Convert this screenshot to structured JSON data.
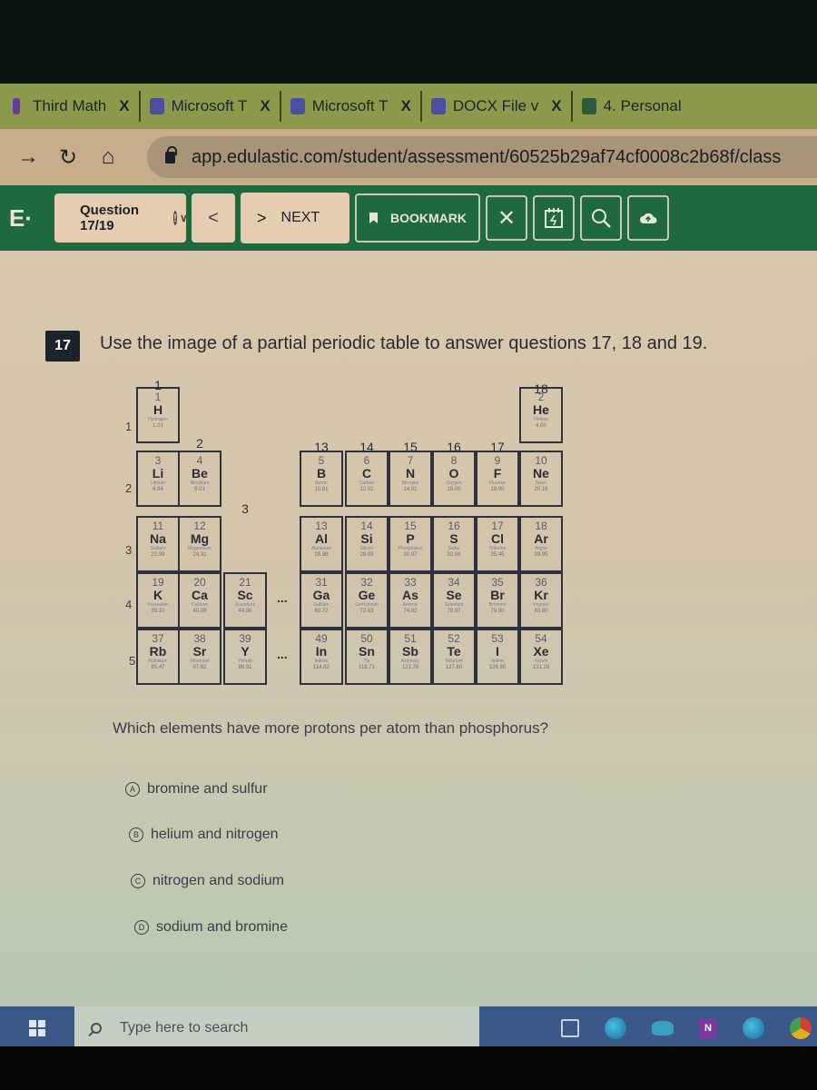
{
  "browser": {
    "tabs": [
      {
        "label": "Third Math",
        "icon": "generic-tab-icon"
      },
      {
        "label": "Microsoft T",
        "icon": "teams-icon"
      },
      {
        "label": "Microsoft T",
        "icon": "teams-icon"
      },
      {
        "label": "DOCX File v",
        "icon": "teams-icon"
      },
      {
        "label": "4. Personal",
        "icon": "forms-icon"
      }
    ],
    "close_glyph": "X",
    "url": "app.edulastic.com/student/assessment/60525b29af74cf0008c2b68f/class"
  },
  "toolbar": {
    "logo": "E·",
    "question_selector": "Question 17/19",
    "alert_glyph": "!",
    "prev_glyph": "<",
    "next_label": "NEXT",
    "next_glyph": ">",
    "bookmark_label": "BOOKMARK",
    "icons": [
      "close-icon",
      "scratchpad-icon",
      "magnifier-icon",
      "upload-icon"
    ]
  },
  "question": {
    "number": "17",
    "intro": "Use the image of a partial periodic table to answer questions 17, 18 and 19.",
    "prompt": "Which elements have more protons per atom than phosphorus?",
    "choices": [
      {
        "letter": "A",
        "text": "bromine and sulfur"
      },
      {
        "letter": "B",
        "text": "helium and nitrogen"
      },
      {
        "letter": "C",
        "text": "nitrogen and sodium"
      },
      {
        "letter": "D",
        "text": "sodium and bromine"
      }
    ]
  },
  "periodic_table": {
    "group_labels": [
      "1",
      "2",
      "3",
      "13",
      "14",
      "15",
      "16",
      "17",
      "18"
    ],
    "period_labels": [
      "1",
      "2",
      "3",
      "4",
      "5"
    ],
    "ellipsis": "...",
    "elements": [
      {
        "num": "1",
        "sym": "H",
        "name": "Hydrogen",
        "mass": "1.01"
      },
      {
        "num": "2",
        "sym": "He",
        "name": "Helium",
        "mass": "4.00"
      },
      {
        "num": "3",
        "sym": "Li",
        "name": "Lithium",
        "mass": "6.94"
      },
      {
        "num": "4",
        "sym": "Be",
        "name": "Beryllium",
        "mass": "9.01"
      },
      {
        "num": "5",
        "sym": "B",
        "name": "Boron",
        "mass": "10.81"
      },
      {
        "num": "6",
        "sym": "C",
        "name": "Carbon",
        "mass": "12.01"
      },
      {
        "num": "7",
        "sym": "N",
        "name": "Nitrogen",
        "mass": "14.01"
      },
      {
        "num": "8",
        "sym": "O",
        "name": "Oxygen",
        "mass": "16.00"
      },
      {
        "num": "9",
        "sym": "F",
        "name": "Fluorine",
        "mass": "19.00"
      },
      {
        "num": "10",
        "sym": "Ne",
        "name": "Neon",
        "mass": "20.18"
      },
      {
        "num": "11",
        "sym": "Na",
        "name": "Sodium",
        "mass": "22.99"
      },
      {
        "num": "12",
        "sym": "Mg",
        "name": "Magnesium",
        "mass": "24.31"
      },
      {
        "num": "13",
        "sym": "Al",
        "name": "Aluminum",
        "mass": "26.98"
      },
      {
        "num": "14",
        "sym": "Si",
        "name": "Silicon",
        "mass": "28.09"
      },
      {
        "num": "15",
        "sym": "P",
        "name": "Phosphorus",
        "mass": "30.97"
      },
      {
        "num": "16",
        "sym": "S",
        "name": "Sulfur",
        "mass": "32.06"
      },
      {
        "num": "17",
        "sym": "Cl",
        "name": "Chlorine",
        "mass": "35.45"
      },
      {
        "num": "18",
        "sym": "Ar",
        "name": "Argon",
        "mass": "39.95"
      },
      {
        "num": "19",
        "sym": "K",
        "name": "Potassium",
        "mass": "39.10"
      },
      {
        "num": "20",
        "sym": "Ca",
        "name": "Calcium",
        "mass": "40.08"
      },
      {
        "num": "21",
        "sym": "Sc",
        "name": "Scandium",
        "mass": "44.96"
      },
      {
        "num": "31",
        "sym": "Ga",
        "name": "Gallium",
        "mass": "69.72"
      },
      {
        "num": "32",
        "sym": "Ge",
        "name": "Germanium",
        "mass": "72.63"
      },
      {
        "num": "33",
        "sym": "As",
        "name": "Arsenic",
        "mass": "74.92"
      },
      {
        "num": "34",
        "sym": "Se",
        "name": "Selenium",
        "mass": "78.97"
      },
      {
        "num": "35",
        "sym": "Br",
        "name": "Bromine",
        "mass": "79.90"
      },
      {
        "num": "36",
        "sym": "Kr",
        "name": "Krypton",
        "mass": "83.80"
      },
      {
        "num": "37",
        "sym": "Rb",
        "name": "Rubidium",
        "mass": "85.47"
      },
      {
        "num": "38",
        "sym": "Sr",
        "name": "Strontium",
        "mass": "87.62"
      },
      {
        "num": "39",
        "sym": "Y",
        "name": "Yttrium",
        "mass": "88.91"
      },
      {
        "num": "49",
        "sym": "In",
        "name": "Indium",
        "mass": "114.82"
      },
      {
        "num": "50",
        "sym": "Sn",
        "name": "Tin",
        "mass": "118.71"
      },
      {
        "num": "51",
        "sym": "Sb",
        "name": "Antimony",
        "mass": "121.76"
      },
      {
        "num": "52",
        "sym": "Te",
        "name": "Tellurium",
        "mass": "127.60"
      },
      {
        "num": "53",
        "sym": "I",
        "name": "Iodine",
        "mass": "126.90"
      },
      {
        "num": "54",
        "sym": "Xe",
        "name": "Xenon",
        "mass": "131.29"
      }
    ]
  },
  "taskbar": {
    "search_placeholder": "Type here to search",
    "onenote_letter": "N",
    "icons": [
      "windows-start-icon",
      "task-view-icon",
      "edge-icon",
      "onedrive-icon",
      "onenote-icon",
      "edge-icon",
      "chrome-icon"
    ]
  }
}
